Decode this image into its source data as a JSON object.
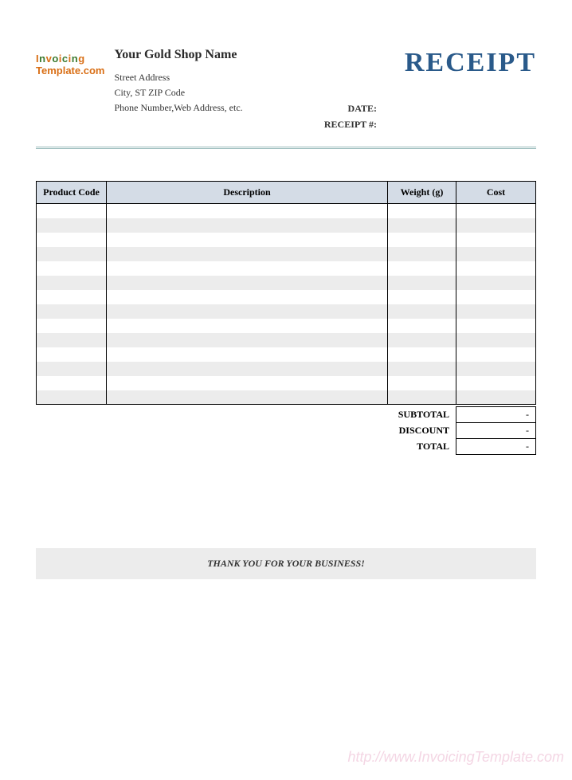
{
  "header": {
    "logo_line1": "Invoicing",
    "logo_line2": "Template.com",
    "shop_name": "Your Gold Shop Name",
    "street": "Street Address",
    "city_line": "City, ST  ZIP Code",
    "contact_line": "Phone Number,Web Address, etc.",
    "title": "RECEIPT",
    "date_label": "DATE:",
    "receipt_no_label": "RECEIPT #:"
  },
  "table": {
    "headers": {
      "code": "Product Code",
      "desc": "Description",
      "weight": "Weight (g)",
      "cost": "Cost"
    },
    "rows": [
      {
        "code": "",
        "desc": "",
        "weight": "",
        "cost": ""
      },
      {
        "code": "",
        "desc": "",
        "weight": "",
        "cost": ""
      },
      {
        "code": "",
        "desc": "",
        "weight": "",
        "cost": ""
      },
      {
        "code": "",
        "desc": "",
        "weight": "",
        "cost": ""
      },
      {
        "code": "",
        "desc": "",
        "weight": "",
        "cost": ""
      },
      {
        "code": "",
        "desc": "",
        "weight": "",
        "cost": ""
      },
      {
        "code": "",
        "desc": "",
        "weight": "",
        "cost": ""
      },
      {
        "code": "",
        "desc": "",
        "weight": "",
        "cost": ""
      },
      {
        "code": "",
        "desc": "",
        "weight": "",
        "cost": ""
      },
      {
        "code": "",
        "desc": "",
        "weight": "",
        "cost": ""
      },
      {
        "code": "",
        "desc": "",
        "weight": "",
        "cost": ""
      },
      {
        "code": "",
        "desc": "",
        "weight": "",
        "cost": ""
      },
      {
        "code": "",
        "desc": "",
        "weight": "",
        "cost": ""
      },
      {
        "code": "",
        "desc": "",
        "weight": "",
        "cost": ""
      }
    ]
  },
  "totals": {
    "subtotal_label": "SUBTOTAL",
    "subtotal_value": "-",
    "discount_label": "DISCOUNT",
    "discount_value": "-",
    "total_label": "TOTAL",
    "total_value": "-"
  },
  "footer": {
    "thank_you": "THANK YOU FOR YOUR BUSINESS!",
    "watermark": "http://www.InvoicingTemplate.com"
  }
}
